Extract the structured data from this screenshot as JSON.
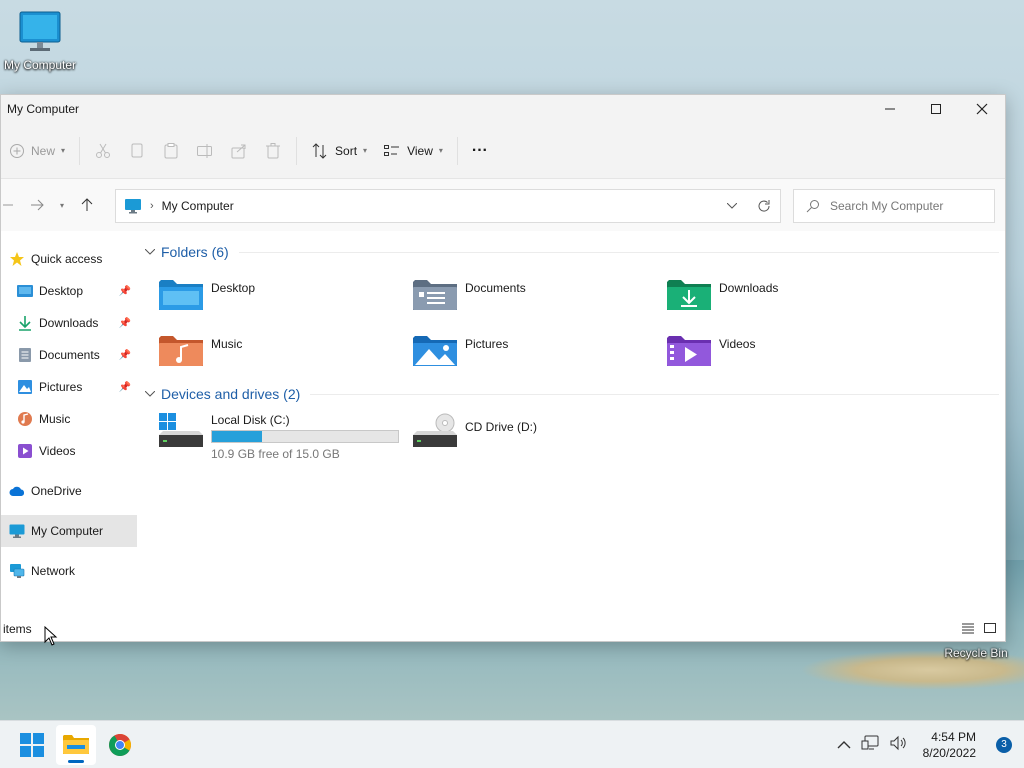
{
  "desktop": {
    "icons": [
      {
        "label": "My Computer"
      },
      {
        "label": "Recycle Bin"
      }
    ]
  },
  "window": {
    "title": "My Computer",
    "toolbar": {
      "new_label": "New",
      "sort_label": "Sort",
      "view_label": "View",
      "more_label": "···"
    },
    "address": {
      "crumb": "My Computer"
    },
    "search": {
      "placeholder": "Search My Computer"
    },
    "sidebar": {
      "quick_access": "Quick access",
      "items": [
        {
          "label": "Desktop",
          "pinned": true
        },
        {
          "label": "Downloads",
          "pinned": true
        },
        {
          "label": "Documents",
          "pinned": true
        },
        {
          "label": "Pictures",
          "pinned": true
        },
        {
          "label": "Music",
          "pinned": false
        },
        {
          "label": "Videos",
          "pinned": false
        }
      ],
      "onedrive": "OneDrive",
      "this_pc": "My Computer",
      "network": "Network"
    },
    "folders_header": "Folders (6)",
    "folders": [
      {
        "label": "Desktop",
        "color": "#2b8fd6"
      },
      {
        "label": "Documents",
        "color": "#7d8ea3"
      },
      {
        "label": "Downloads",
        "color": "#1aa36b"
      },
      {
        "label": "Music",
        "color": "#e07a4f"
      },
      {
        "label": "Pictures",
        "color": "#2e8fe0"
      },
      {
        "label": "Videos",
        "color": "#8a4fd0"
      }
    ],
    "drives_header": "Devices and drives (2)",
    "drives": [
      {
        "label": "Local Disk (C:)",
        "free_text": "10.9 GB free of 15.0 GB",
        "used_fraction": 0.27
      },
      {
        "label": "CD Drive (D:)"
      }
    ],
    "status": {
      "items_text": "items"
    }
  },
  "taskbar": {
    "time": "4:54 PM",
    "date": "8/20/2022",
    "notifications": "3"
  }
}
